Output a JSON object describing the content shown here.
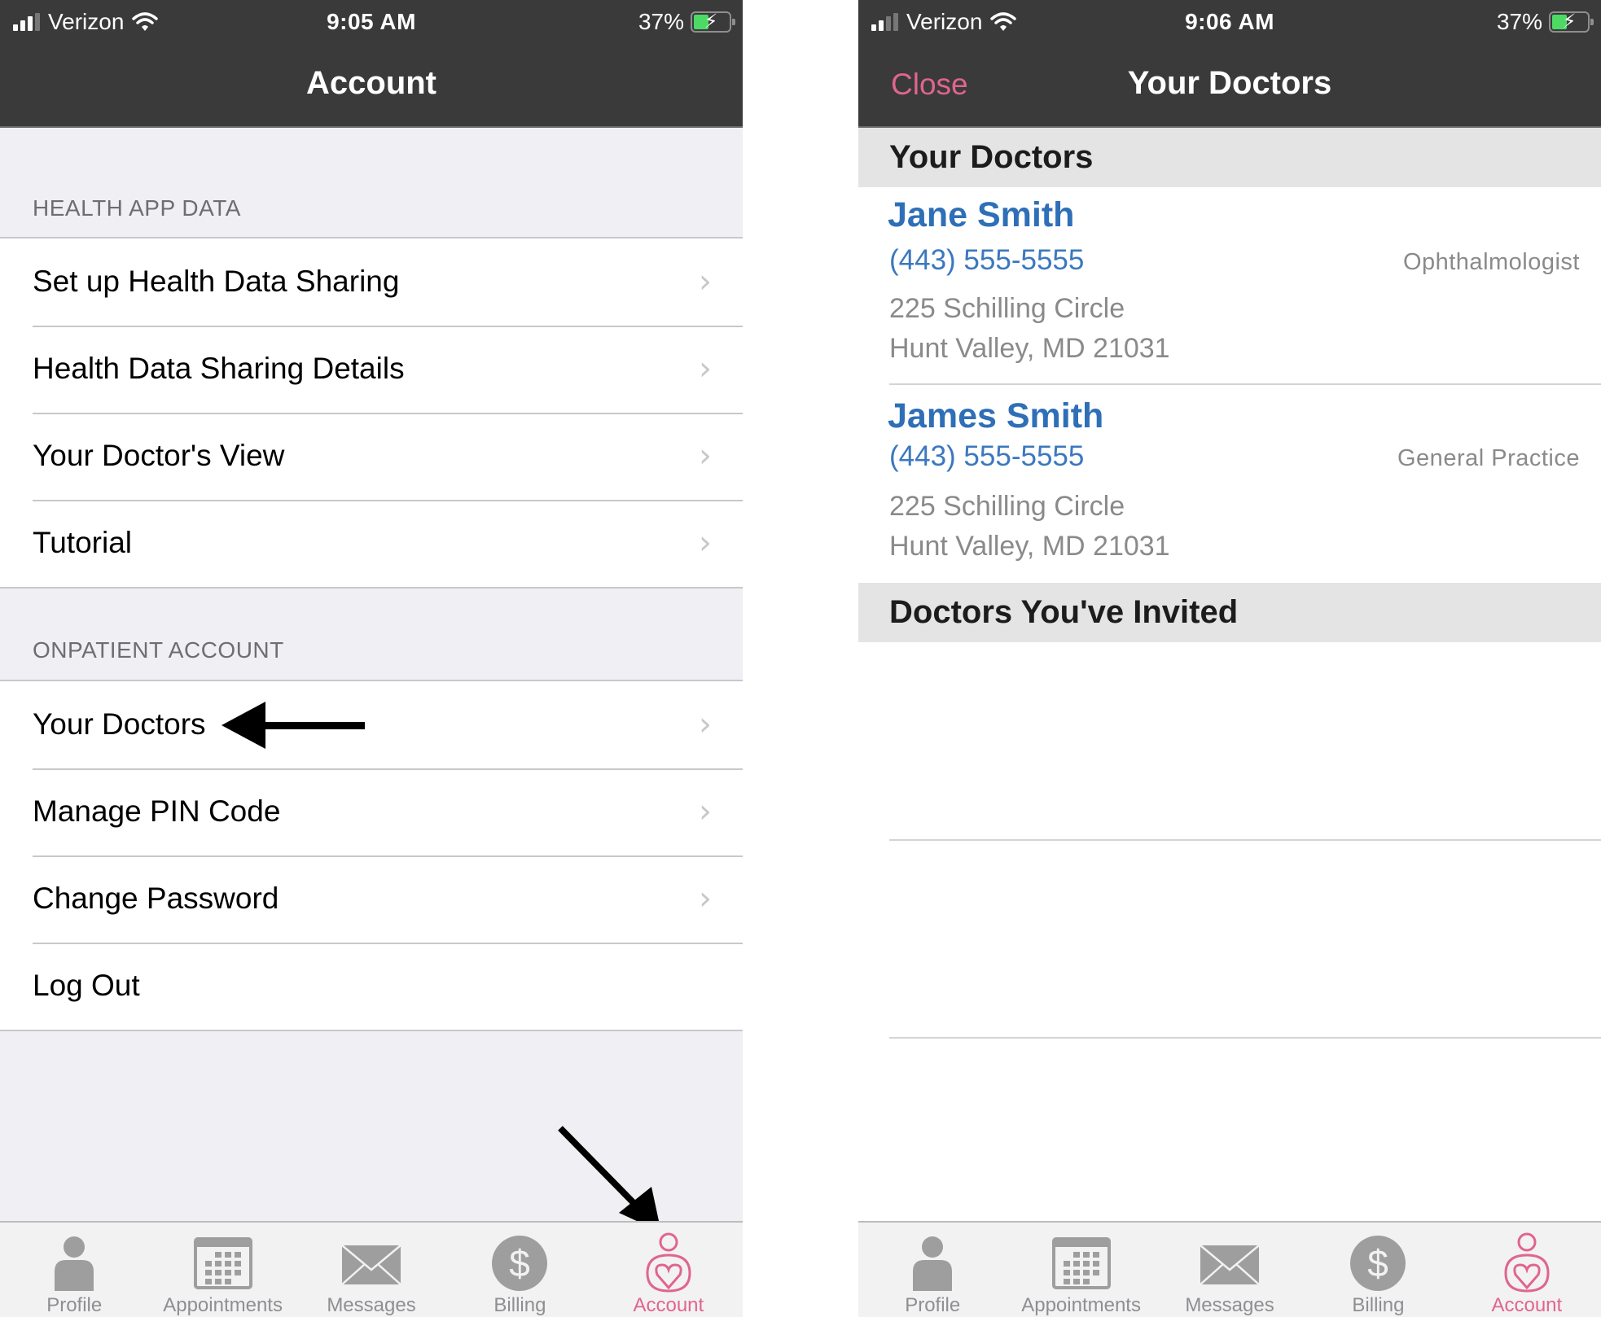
{
  "left_screen": {
    "status_bar": {
      "carrier": "Verizon",
      "time": "9:05 AM",
      "battery_percent": "37%",
      "signal_bars": 3,
      "signal_bars_total": 4,
      "battery_level": 0.37,
      "charging_icon": "lightning-bolt"
    },
    "nav_title": "Account",
    "sections": [
      {
        "header": "HEALTH APP DATA",
        "items": [
          {
            "label": "Set up Health Data Sharing",
            "chevron": true
          },
          {
            "label": "Health Data Sharing Details",
            "chevron": true
          },
          {
            "label": "Your Doctor's View",
            "chevron": true
          },
          {
            "label": "Tutorial",
            "chevron": true
          }
        ]
      },
      {
        "header": "ONPATIENT ACCOUNT",
        "items": [
          {
            "label": "Your Doctors",
            "chevron": true
          },
          {
            "label": "Manage PIN Code",
            "chevron": true
          },
          {
            "label": "Change Password",
            "chevron": true
          },
          {
            "label": "Log Out",
            "chevron": false
          }
        ]
      }
    ],
    "chevron_glyph": "›",
    "tabs": [
      {
        "label": "Profile",
        "icon": "person-icon",
        "active": false
      },
      {
        "label": "Appointments",
        "icon": "calendar-icon",
        "active": false
      },
      {
        "label": "Messages",
        "icon": "envelope-icon",
        "active": false
      },
      {
        "label": "Billing",
        "icon": "dollar-icon",
        "active": false
      },
      {
        "label": "Account",
        "icon": "account-heart-icon",
        "active": true
      }
    ]
  },
  "right_screen": {
    "status_bar": {
      "carrier": "Verizon",
      "time": "9:06 AM",
      "battery_percent": "37%",
      "signal_bars": 2,
      "signal_bars_total": 4,
      "battery_level": 0.37,
      "charging_icon": "lightning-bolt"
    },
    "nav_title": "Your Doctors",
    "close_label": "Close",
    "your_doctors_header": "Your Doctors",
    "doctors": [
      {
        "name": "Jane Smith",
        "phone": "(443) 555-5555",
        "specialty": "Ophthalmologist",
        "address_line1": "225 Schilling Circle",
        "address_line2": "Hunt Valley, MD 21031"
      },
      {
        "name": "James Smith",
        "phone": "(443) 555-5555",
        "specialty": "General Practice",
        "address_line1": "225 Schilling Circle",
        "address_line2": "Hunt Valley, MD 21031"
      }
    ],
    "invited_header": "Doctors You've Invited",
    "invited_doctors": [],
    "tabs": [
      {
        "label": "Profile",
        "icon": "person-icon",
        "active": false
      },
      {
        "label": "Appointments",
        "icon": "calendar-icon",
        "active": false
      },
      {
        "label": "Messages",
        "icon": "envelope-icon",
        "active": false
      },
      {
        "label": "Billing",
        "icon": "dollar-icon",
        "active": false
      },
      {
        "label": "Account",
        "icon": "account-heart-icon",
        "active": true
      }
    ]
  },
  "colors": {
    "nav_background": "#3a3a3a",
    "accent_pink": "#e0658e",
    "link_blue": "#2e6fb7",
    "grouped_background": "#efeff4",
    "section_band": "#e4e4e4",
    "inactive_tab": "#8e8e93",
    "battery_green": "#4cd964"
  },
  "annotations": [
    {
      "type": "arrow",
      "points_to": "Your Doctors menu item"
    },
    {
      "type": "arrow",
      "points_to": "Account tab"
    }
  ]
}
